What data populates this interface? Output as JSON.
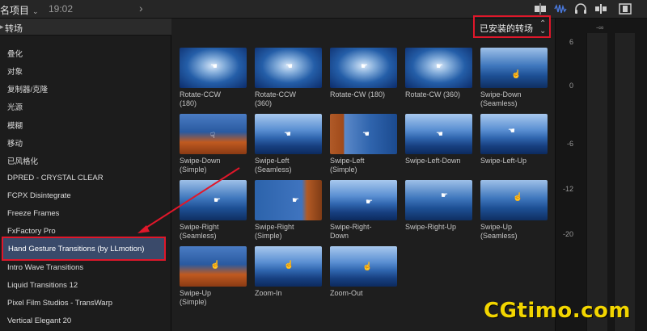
{
  "topbar": {
    "project_label": "名项目",
    "timecode": "19:02"
  },
  "sidebar": {
    "header": "转场",
    "categories": [
      "叠化",
      "对象",
      "复制器/克隆",
      "光源",
      "模糊",
      "移动",
      "已风格化",
      "DPRED - CRYSTAL CLEAR",
      "FCPX Disintegrate",
      "Freeze Frames",
      "FxFactory Pro",
      "Hand Gesture Transitions (by LLmotion)",
      "Intro Wave Transitions",
      "Liquid Transitions 12",
      "Pixel Film Studios - TransWarp",
      "Vertical Elegant 20"
    ],
    "selected_index": 11
  },
  "browser": {
    "filter_label": "已安装的转场",
    "tiles": [
      "Rotate-CCW\n(180)",
      "Rotate-CCW\n(360)",
      "Rotate-CW (180)",
      "Rotate-CW (360)",
      "Swipe-Down\n(Seamless)",
      "Swipe-Down\n(Simple)",
      "Swipe-Left\n(Seamless)",
      "Swipe-Left\n(Simple)",
      "Swipe-Left-Down",
      "Swipe-Left-Up",
      "Swipe-Right\n(Seamless)",
      "Swipe-Right\n(Simple)",
      "Swipe-Right-\nDown",
      "Swipe-Right-Up",
      "Swipe-Up\n(Seamless)",
      "Swipe-Up\n(Simple)",
      "Zoom-In",
      "Zoom-Out"
    ]
  },
  "meter": {
    "top_label": "-∞",
    "scale": [
      "6",
      "0",
      "-6",
      "-12",
      "-20"
    ]
  },
  "watermark": "CGtimo.com",
  "colors": {
    "highlight_border": "#e0172a",
    "selection_bg": "#3a4a6a",
    "watermark": "#f2d500"
  }
}
